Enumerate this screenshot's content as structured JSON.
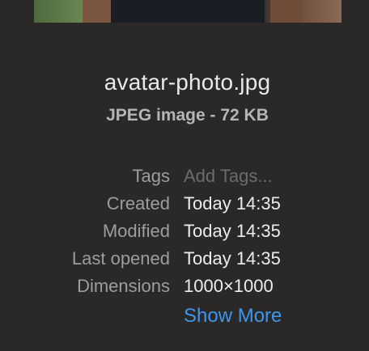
{
  "file": {
    "name": "avatar-photo.jpg",
    "kind": "JPEG image - 72 KB"
  },
  "info": {
    "tags": {
      "label": "Tags",
      "placeholder": "Add Tags..."
    },
    "created": {
      "label": "Created",
      "value": "Today 14:35"
    },
    "modified": {
      "label": "Modified",
      "value": "Today 14:35"
    },
    "last_opened": {
      "label": "Last opened",
      "value": "Today 14:35"
    },
    "dimensions": {
      "label": "Dimensions",
      "value": "1000×1000"
    }
  },
  "actions": {
    "show_more": "Show More"
  },
  "colors": {
    "background": "#2a2928",
    "link": "#3d96ee"
  }
}
